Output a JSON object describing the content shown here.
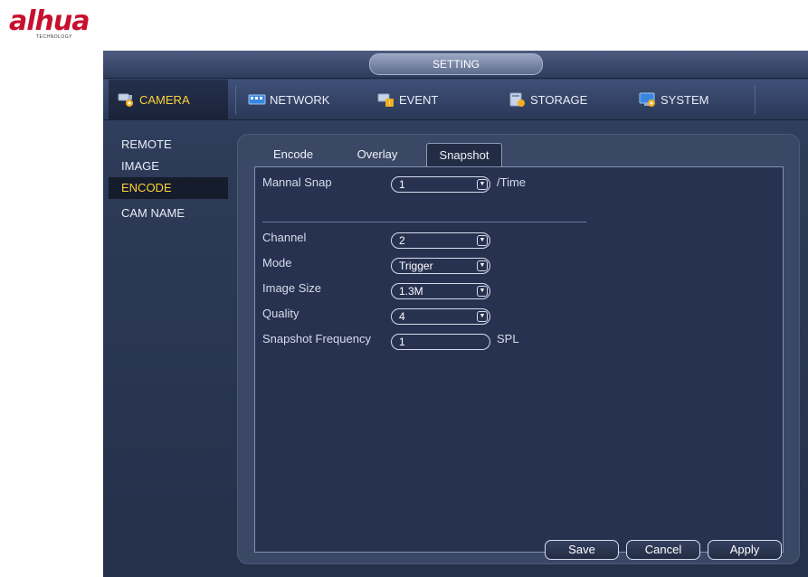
{
  "brand": {
    "logo_text": "alhua",
    "logo_subtext": "TECHNOLOGY"
  },
  "window": {
    "title": "SETTING"
  },
  "topnav": {
    "items": [
      {
        "label": "CAMERA",
        "icon": "camera-icon",
        "active": true
      },
      {
        "label": "NETWORK",
        "icon": "network-icon"
      },
      {
        "label": "EVENT",
        "icon": "event-icon"
      },
      {
        "label": "STORAGE",
        "icon": "storage-icon"
      },
      {
        "label": "SYSTEM",
        "icon": "system-icon"
      }
    ]
  },
  "sidebar": {
    "items": [
      {
        "label": "REMOTE"
      },
      {
        "label": "IMAGE"
      },
      {
        "label": "ENCODE",
        "active": true
      },
      {
        "label": "CAM NAME"
      }
    ]
  },
  "tabs": [
    {
      "label": "Encode"
    },
    {
      "label": "Overlay"
    },
    {
      "label": "Snapshot",
      "active": true
    }
  ],
  "form": {
    "manual_snap": {
      "label": "Mannal Snap",
      "value": "1",
      "unit": "/Time"
    },
    "channel": {
      "label": "Channel",
      "value": "2"
    },
    "mode": {
      "label": "Mode",
      "value": "Trigger"
    },
    "image_size": {
      "label": "Image Size",
      "value": "1.3M"
    },
    "quality": {
      "label": "Quality",
      "value": "4"
    },
    "snapshot_frequency": {
      "label": "Snapshot Frequency",
      "value": "1",
      "unit": "SPL"
    }
  },
  "buttons": {
    "save": "Save",
    "cancel": "Cancel",
    "apply": "Apply"
  },
  "colors": {
    "active_text": "#ffd23c",
    "background": "#2e3c5a",
    "brand": "#c8102e"
  }
}
